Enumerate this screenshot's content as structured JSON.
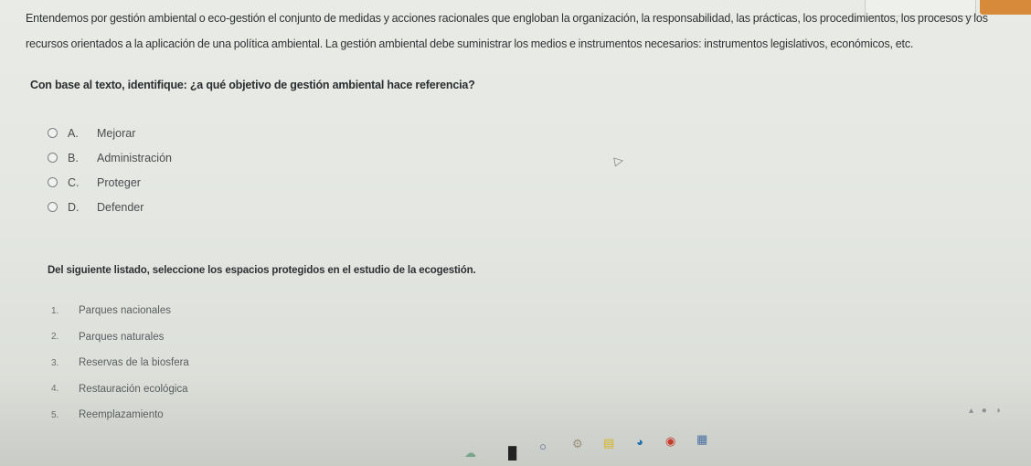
{
  "paragraph": "Entendemos por gestión ambiental o eco-gestión el conjunto de medidas y acciones racionales que engloban la organización, la responsabilidad, las prácticas, los procedimientos, los procesos y los recursos orientados a la aplicación de una política ambiental. La gestión ambiental debe suministrar los medios e instrumentos necesarios: instrumentos legislativos, económicos, etc.",
  "question1": {
    "text": "Con base al texto, identifique: ¿a qué objetivo de gestión ambiental hace referencia?",
    "options": [
      {
        "letter": "A.",
        "label": "Mejorar"
      },
      {
        "letter": "B.",
        "label": "Administración"
      },
      {
        "letter": "C.",
        "label": "Proteger"
      },
      {
        "letter": "D.",
        "label": "Defender"
      }
    ]
  },
  "question2": {
    "text": "Del siguiente listado, seleccione los espacios protegidos en el estudio de la ecogestión.",
    "items": [
      {
        "num": "1.",
        "label": "Parques nacionales"
      },
      {
        "num": "2.",
        "label": "Parques naturales"
      },
      {
        "num": "3.",
        "label": "Reservas de la biosfera"
      },
      {
        "num": "4.",
        "label": "Restauración ecológica"
      },
      {
        "num": "5.",
        "label": "Reemplazamiento"
      }
    ]
  },
  "colors": {
    "accent_button": "#d78a3a",
    "background": "#e6e9e4"
  },
  "icons": [
    "mouse-cursor-icon",
    "widgets-icon",
    "start-icon",
    "search-icon",
    "settings-icon",
    "file-explorer-icon",
    "edge-browser-icon",
    "chrome-icon",
    "app-icon",
    "tray-icons"
  ]
}
